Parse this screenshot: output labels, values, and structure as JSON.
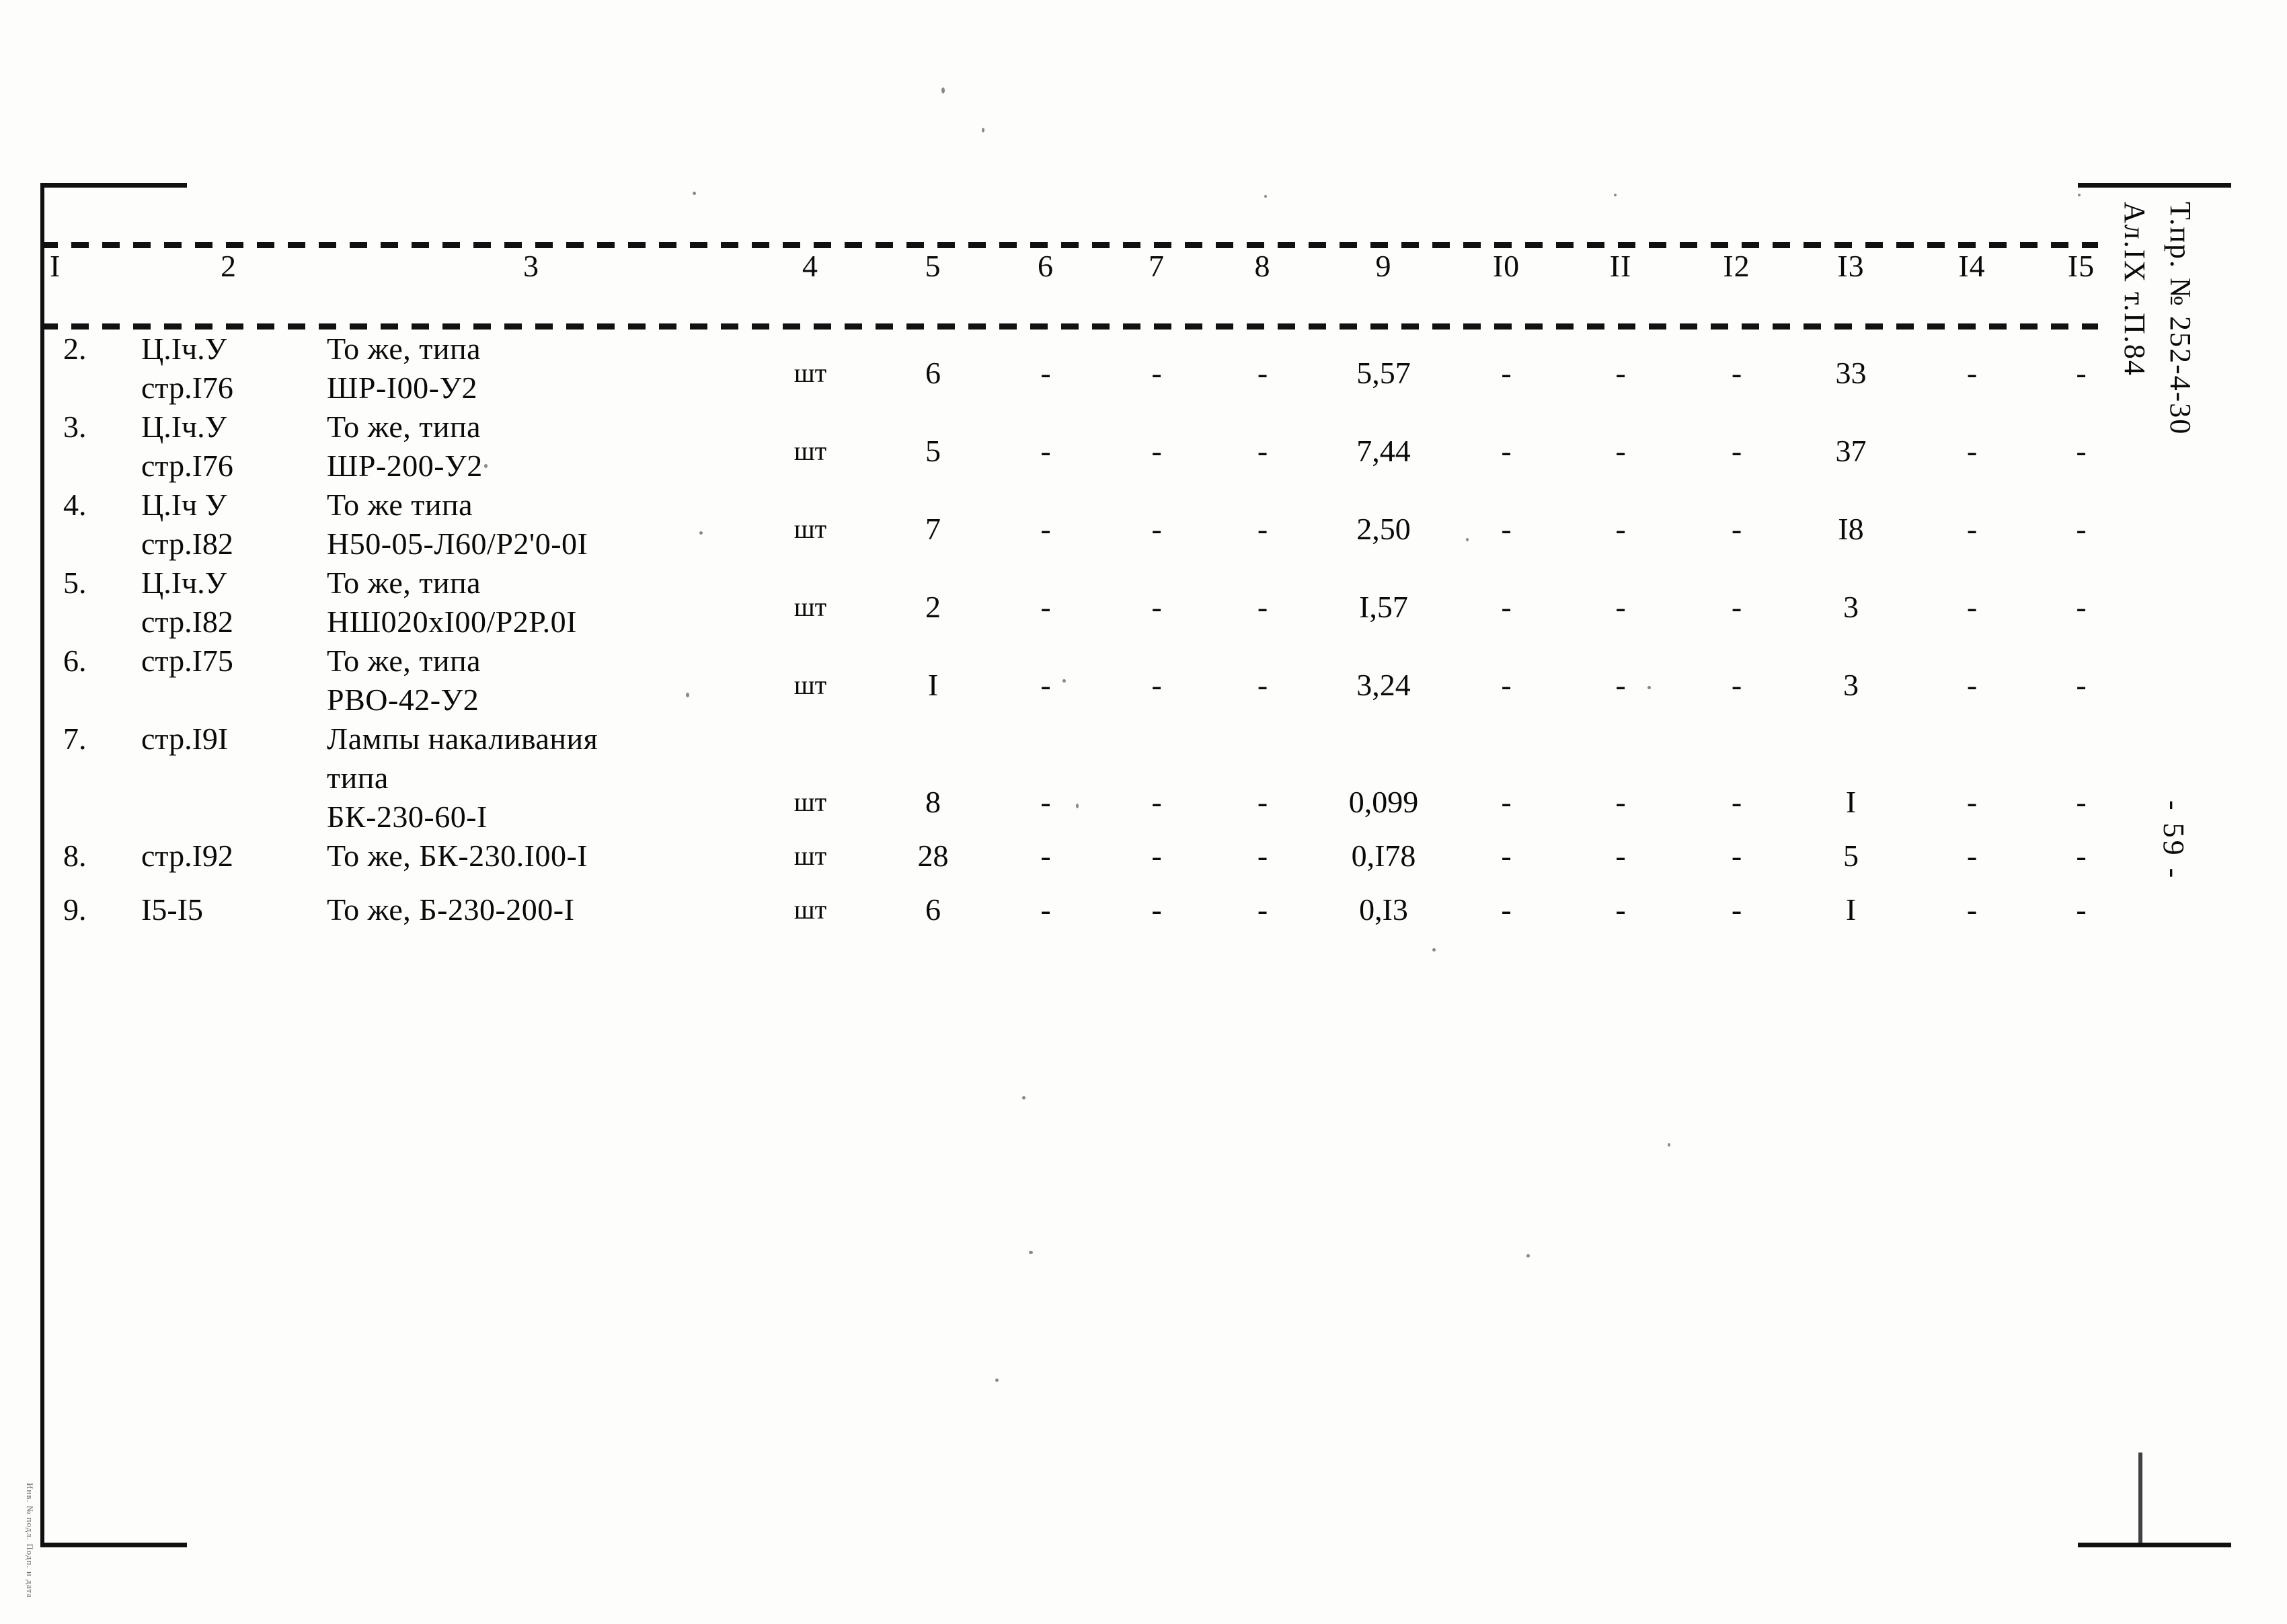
{
  "document": {
    "doc_code_line_1": "Т.пр. № 252-4-30",
    "doc_code_line_2": "Ал.IX т.П.84",
    "page_number_mark": "- 59 -",
    "archive_stamp": "Инв. № подл. Подп. и дата"
  },
  "table": {
    "column_headers": [
      "I",
      "2",
      "3",
      "4",
      "5",
      "6",
      "7",
      "8",
      "9",
      "I0",
      "II",
      "I2",
      "I3",
      "I4",
      "I5"
    ],
    "rows": [
      {
        "num": "2.",
        "ref": "Ц.Iч.У\nстр.I76",
        "name": "То же, типа\nШР-I00-У2",
        "unit": "шт",
        "qty": "6",
        "c6": "-",
        "c7": "-",
        "c8": "-",
        "c9": "5,57",
        "c10": "-",
        "c11": "-",
        "c12": "-",
        "c13": "33",
        "c14": "-",
        "c15": "-"
      },
      {
        "num": "3.",
        "ref": "Ц.Iч.У\nстр.I76",
        "name": "То же, типа\nШР-200-У2",
        "unit": "шт",
        "qty": "5",
        "c6": "-",
        "c7": "-",
        "c8": "-",
        "c9": "7,44",
        "c10": "-",
        "c11": "-",
        "c12": "-",
        "c13": "37",
        "c14": "-",
        "c15": "-"
      },
      {
        "num": "4.",
        "ref": "Ц.Iч У\nстр.I82",
        "name": "То же типа\nН50-05-Л60/Р2'0-0I",
        "unit": "шт",
        "qty": "7",
        "c6": "-",
        "c7": "-",
        "c8": "-",
        "c9": "2,50",
        "c10": "-",
        "c11": "-",
        "c12": "-",
        "c13": "I8",
        "c14": "-",
        "c15": "-"
      },
      {
        "num": "5.",
        "ref": "Ц.Iч.У\nстр.I82",
        "name": "То же, типа\nНШ020хI00/Р2Р.0I",
        "unit": "шт",
        "qty": "2",
        "c6": "-",
        "c7": "-",
        "c8": "-",
        "c9": "I,57",
        "c10": "-",
        "c11": "-",
        "c12": "-",
        "c13": "3",
        "c14": "-",
        "c15": "-"
      },
      {
        "num": "6.",
        "ref": "стр.I75",
        "name": "То же, типа\nРВО-42-У2",
        "unit": "шт",
        "qty": "I",
        "c6": "-",
        "c7": "-",
        "c8": "-",
        "c9": "3,24",
        "c10": "-",
        "c11": "-",
        "c12": "-",
        "c13": "3",
        "c14": "-",
        "c15": "-"
      },
      {
        "num": "7.",
        "ref": "стр.I9I",
        "name": "Лампы накаливания\nтипа\nБК-230-60-I",
        "unit": "шт",
        "qty": "8",
        "c6": "-",
        "c7": "-",
        "c8": "-",
        "c9": "0,099",
        "c10": "-",
        "c11": "-",
        "c12": "-",
        "c13": "I",
        "c14": "-",
        "c15": "-"
      },
      {
        "num": "8.",
        "ref": "стр.I92",
        "name": "То же, БК-230.I00-I",
        "unit": "шт",
        "qty": "28",
        "c6": "-",
        "c7": "-",
        "c8": "-",
        "c9": "0,I78",
        "c10": "-",
        "c11": "-",
        "c12": "-",
        "c13": "5",
        "c14": "-",
        "c15": "-"
      },
      {
        "num": "9.",
        "ref": "I5-I5",
        "name": "То же, Б-230-200-I",
        "unit": "шт",
        "qty": "6",
        "c6": "-",
        "c7": "-",
        "c8": "-",
        "c9": "0,I3",
        "c10": "-",
        "c11": "-",
        "c12": "-",
        "c13": "I",
        "c14": "-",
        "c15": "-"
      }
    ]
  }
}
